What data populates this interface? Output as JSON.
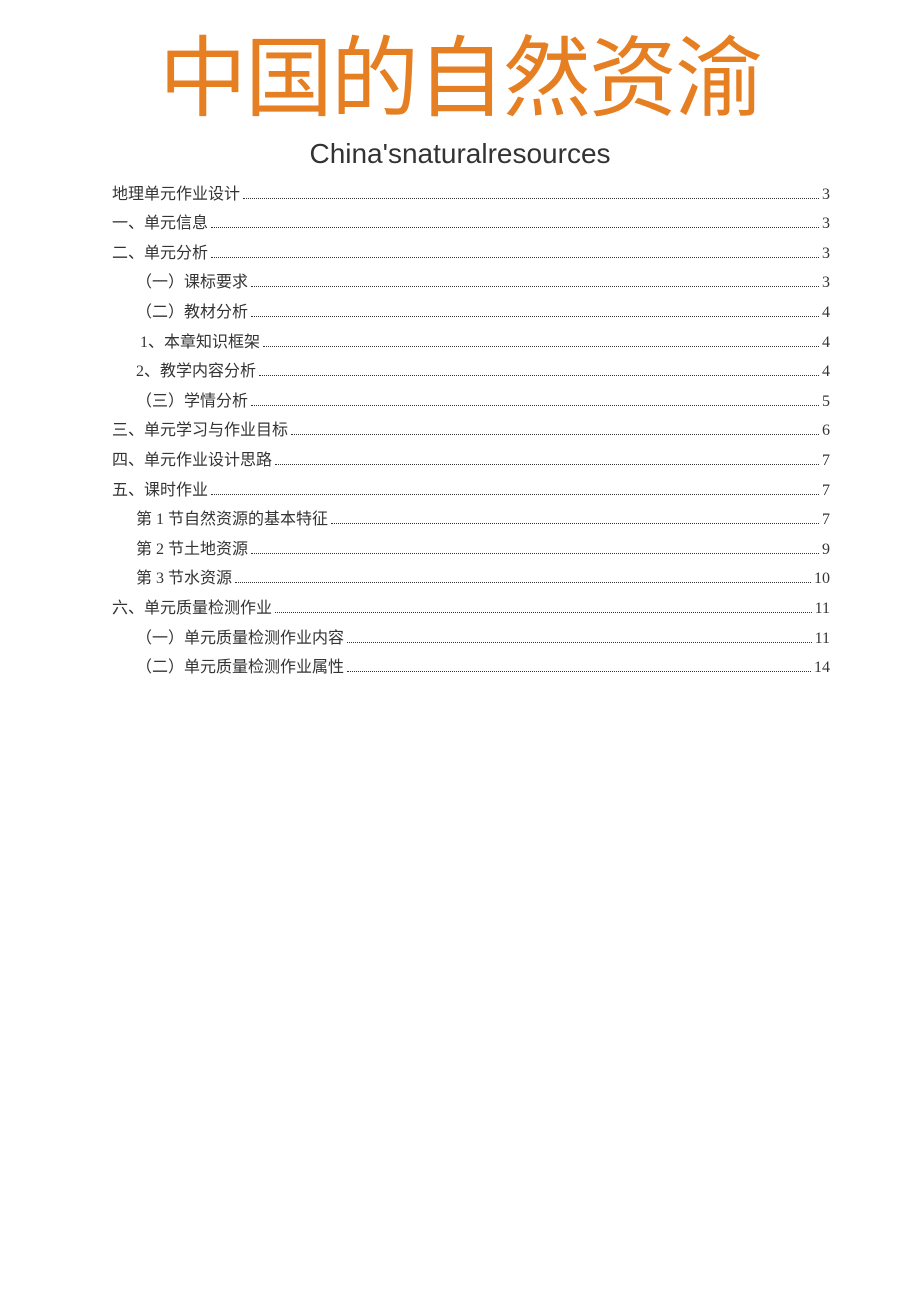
{
  "title": {
    "main": "中国的自然资渝",
    "sub": "China'snaturalresources"
  },
  "toc": [
    {
      "label": "地理单元作业设计",
      "page": "3",
      "indent": 0
    },
    {
      "label": "一、单元信息",
      "page": "3",
      "indent": 0
    },
    {
      "label": "二、单元分析",
      "page": "3",
      "indent": 0
    },
    {
      "label": "（一）课标要求",
      "page": "3",
      "indent": 1
    },
    {
      "label": "（二）教材分析",
      "page": "4",
      "indent": 1
    },
    {
      "label": "1、本章知识框架",
      "page": "4",
      "indent": 2
    },
    {
      "label": "2、教学内容分析",
      "page": "4",
      "indent": 1
    },
    {
      "label": "（三）学情分析",
      "page": "5",
      "indent": 1
    },
    {
      "label": "三、单元学习与作业目标",
      "page": "6",
      "indent": 0
    },
    {
      "label": "四、单元作业设计思路",
      "page": "7",
      "indent": 0
    },
    {
      "label": "五、课时作业",
      "page": "7",
      "indent": 0
    },
    {
      "label": "第 1 节自然资源的基本特征",
      "page": "7",
      "indent": 1
    },
    {
      "label": "第 2 节土地资源",
      "page": "9",
      "indent": 1
    },
    {
      "label": "第 3 节水资源",
      "page": "10",
      "indent": 1
    },
    {
      "label": "六、单元质量检测作业",
      "page": "11",
      "indent": 0
    },
    {
      "label": "（一）单元质量检测作业内容",
      "page": "11",
      "indent": 1
    },
    {
      "label": "（二）单元质量检测作业属性",
      "page": "14",
      "indent": 1
    }
  ]
}
